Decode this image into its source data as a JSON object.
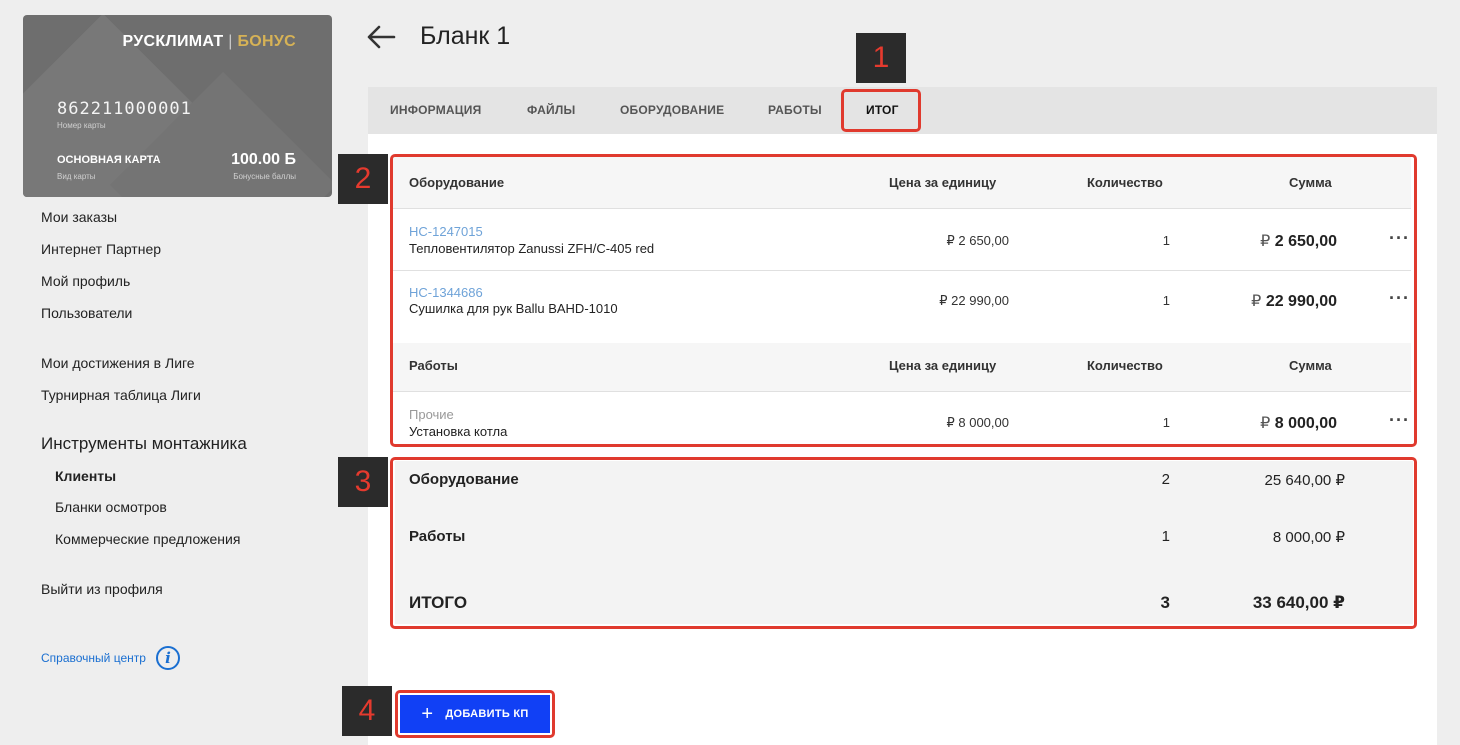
{
  "card": {
    "brand_left": "РУСКЛИМАТ",
    "brand_sep": "|",
    "brand_right": "БОНУС",
    "number": "862211000001",
    "number_label": "Номер карты",
    "type": "ОСНОВНАЯ КАРТА",
    "type_label": "Вид карты",
    "points": "100.00 Б",
    "points_label": "Бонусные баллы"
  },
  "sidebar": {
    "items": [
      "Мои заказы",
      "Интернет Партнер",
      "Мой профиль",
      "Пользователи"
    ],
    "league": [
      "Мои достижения в Лиге",
      "Турнирная таблица Лиги"
    ],
    "tools_title": "Инструменты монтажника",
    "tools": [
      "Клиенты",
      "Бланки осмотров",
      "Коммерческие предложения"
    ],
    "logout": "Выйти из профиля",
    "help": "Справочный центр"
  },
  "header": {
    "title": "Бланк 1"
  },
  "tabs": [
    "ИНФОРМАЦИЯ",
    "ФАЙЛЫ",
    "ОБОРУДОВАНИЕ",
    "РАБОТЫ",
    "ИТОГ"
  ],
  "markers": [
    "1",
    "2",
    "3",
    "4"
  ],
  "equipment": {
    "header": {
      "name": "Оборудование",
      "price": "Цена за единицу",
      "qty": "Количество",
      "sum": "Сумма"
    },
    "rows": [
      {
        "code": "НС-1247015",
        "name": "Тепловентилятор Zanussi ZFH/C-405 red",
        "price": "₽ 2 650,00",
        "qty": "1",
        "sum_cur": "₽",
        "sum": "2 650,00"
      },
      {
        "code": "НС-1344686",
        "name": "Сушилка для рук Ballu BAHD-1010",
        "price": "₽ 22 990,00",
        "qty": "1",
        "sum_cur": "₽",
        "sum": "22 990,00"
      }
    ]
  },
  "works": {
    "header": {
      "name": "Работы",
      "price": "Цена за единицу",
      "qty": "Количество",
      "sum": "Сумма"
    },
    "rows": [
      {
        "code": "Прочие",
        "name": "Установка котла",
        "price": "₽ 8 000,00",
        "qty": "1",
        "sum_cur": "₽",
        "sum": "8 000,00"
      }
    ]
  },
  "summary": [
    {
      "label": "Оборудование",
      "qty": "2",
      "total": "25 640,00 ₽"
    },
    {
      "label": "Работы",
      "qty": "1",
      "total": "8 000,00 ₽"
    },
    {
      "label": "ИТОГО",
      "qty": "3",
      "total": "33 640,00 ₽"
    }
  ],
  "add_button": {
    "label": "ДОБАВИТЬ КП",
    "icon": "+"
  },
  "colors": {
    "accent_blue": "#1140f5",
    "highlight_red": "#e03a2e",
    "link_blue": "#6fa3d8",
    "bonus_gold": "#d6b256"
  }
}
